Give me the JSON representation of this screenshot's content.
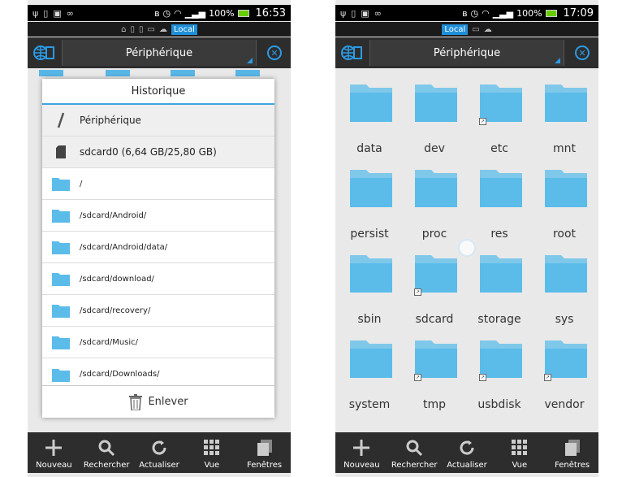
{
  "left": {
    "status": {
      "battery": "100%",
      "time": "16:53"
    },
    "location": "Local",
    "toolbar_title": "Périphérique",
    "dialog": {
      "title": "Historique",
      "items": [
        {
          "label": "Périphérique",
          "icon": "slash-icon"
        },
        {
          "label": "sdcard0 (6,64 GB/25,80 GB)",
          "icon": "sdcard-icon"
        },
        {
          "label": "/",
          "icon": "folder-icon"
        },
        {
          "label": "/sdcard/Android/",
          "icon": "folder-icon"
        },
        {
          "label": "/sdcard/Android/data/",
          "icon": "folder-icon"
        },
        {
          "label": "/sdcard/download/",
          "icon": "folder-icon"
        },
        {
          "label": "/sdcard/recovery/",
          "icon": "folder-icon"
        },
        {
          "label": "/sdcard/Music/",
          "icon": "folder-icon"
        },
        {
          "label": "/sdcard/Downloads/",
          "icon": "folder-icon"
        }
      ],
      "footer": "Enlever"
    }
  },
  "right": {
    "status": {
      "battery": "100%",
      "time": "17:09"
    },
    "location": "Local",
    "toolbar_title": "Périphérique",
    "folders": [
      {
        "name": "data",
        "link": false
      },
      {
        "name": "dev",
        "link": false
      },
      {
        "name": "etc",
        "link": true
      },
      {
        "name": "mnt",
        "link": false
      },
      {
        "name": "persist",
        "link": false
      },
      {
        "name": "proc",
        "link": false
      },
      {
        "name": "res",
        "link": false
      },
      {
        "name": "root",
        "link": false
      },
      {
        "name": "sbin",
        "link": false
      },
      {
        "name": "sdcard",
        "link": true
      },
      {
        "name": "storage",
        "link": false
      },
      {
        "name": "sys",
        "link": false
      },
      {
        "name": "system",
        "link": false
      },
      {
        "name": "tmp",
        "link": true
      },
      {
        "name": "usbdisk",
        "link": true
      },
      {
        "name": "vendor",
        "link": true
      }
    ]
  },
  "bottom_bar": [
    {
      "label": "Nouveau",
      "icon": "plus-icon"
    },
    {
      "label": "Rechercher",
      "icon": "search-icon"
    },
    {
      "label": "Actualiser",
      "icon": "refresh-icon"
    },
    {
      "label": "Vue",
      "icon": "grid-icon"
    },
    {
      "label": "Fenêtres",
      "icon": "windows-icon"
    }
  ],
  "colors": {
    "folder": "#5bbcea",
    "accent": "#2b9be6",
    "bar": "#2d2d2d"
  }
}
